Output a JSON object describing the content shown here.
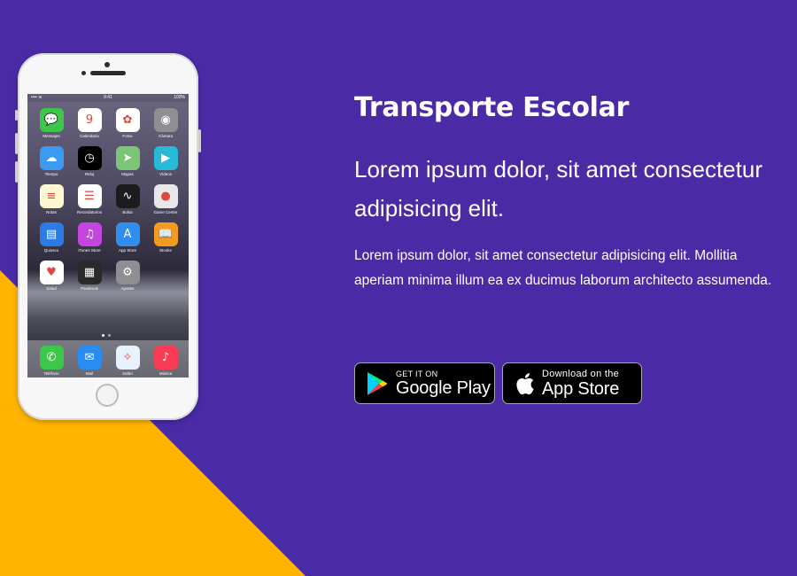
{
  "colors": {
    "background": "#4b2aa6",
    "accent_wedge": "#ffb400",
    "text": "#ffffff"
  },
  "hero": {
    "title": "Transporte Escolar",
    "lead": "Lorem ipsum dolor, sit amet consectetur adipisicing elit.",
    "body": "Lorem ipsum dolor, sit amet consectetur adipisicing elit. Mollitia aperiam minima illum ea ex ducimus laborum architecto assumenda."
  },
  "stores": {
    "google_play": {
      "small": "GET IT ON",
      "big": "Google Play",
      "icon": "google-play-icon"
    },
    "app_store": {
      "small": "Download on the",
      "big": "App Store",
      "icon": "apple-icon"
    }
  },
  "phone": {
    "status": {
      "left": "•••• ≋",
      "time": "9:41",
      "right": "100%"
    },
    "apps": [
      {
        "label": "Mensajes",
        "icon": "messages-icon",
        "color": "#3cc74b",
        "glyph": "💬"
      },
      {
        "label": "Calendario",
        "icon": "calendar-icon",
        "color": "#ffffff",
        "glyph": "9"
      },
      {
        "label": "Fotos",
        "icon": "photos-icon",
        "color": "#ffffff",
        "glyph": "✿"
      },
      {
        "label": "Cámara",
        "icon": "camera-icon",
        "color": "#8e8e93",
        "glyph": "◉"
      },
      {
        "label": "Tiempo",
        "icon": "weather-icon",
        "color": "#3a9bf0",
        "glyph": "☁"
      },
      {
        "label": "Reloj",
        "icon": "clock-icon",
        "color": "#000000",
        "glyph": "◷"
      },
      {
        "label": "Mapas",
        "icon": "maps-icon",
        "color": "#7cc576",
        "glyph": "➤"
      },
      {
        "label": "Vídeos",
        "icon": "videos-icon",
        "color": "#28b9d8",
        "glyph": "▶"
      },
      {
        "label": "Notas",
        "icon": "notes-icon",
        "color": "#fff7d1",
        "glyph": "≡"
      },
      {
        "label": "Recordatorios",
        "icon": "reminders-icon",
        "color": "#ffffff",
        "glyph": "☰"
      },
      {
        "label": "Bolsa",
        "icon": "stocks-icon",
        "color": "#1c1c1e",
        "glyph": "∿"
      },
      {
        "label": "Game Center",
        "icon": "game-center-icon",
        "color": "#e8e8ea",
        "glyph": "●"
      },
      {
        "label": "Quiosco",
        "icon": "newsstand-icon",
        "color": "#2c7be5",
        "glyph": "▤"
      },
      {
        "label": "iTunes Store",
        "icon": "itunes-icon",
        "color": "#c644e0",
        "glyph": "♫"
      },
      {
        "label": "App Store",
        "icon": "app-store-icon",
        "color": "#2f8ef0",
        "glyph": "A"
      },
      {
        "label": "iBooks",
        "icon": "ibooks-icon",
        "color": "#f49b1f",
        "glyph": "📖"
      },
      {
        "label": "Salud",
        "icon": "health-icon",
        "color": "#ffffff",
        "glyph": "♥"
      },
      {
        "label": "Passbook",
        "icon": "passbook-icon",
        "color": "#2a2a2a",
        "glyph": "▦"
      },
      {
        "label": "Ajustes",
        "icon": "settings-icon",
        "color": "#8e8e93",
        "glyph": "⚙"
      }
    ],
    "dock": [
      {
        "label": "Teléfono",
        "icon": "phone-icon",
        "color": "#3cc74b",
        "glyph": "✆"
      },
      {
        "label": "Mail",
        "icon": "mail-icon",
        "color": "#2a8cf0",
        "glyph": "✉"
      },
      {
        "label": "Safari",
        "icon": "safari-icon",
        "color": "#e8f2ff",
        "glyph": "✧"
      },
      {
        "label": "Música",
        "icon": "music-icon",
        "color": "#fb3a54",
        "glyph": "♪"
      }
    ]
  }
}
